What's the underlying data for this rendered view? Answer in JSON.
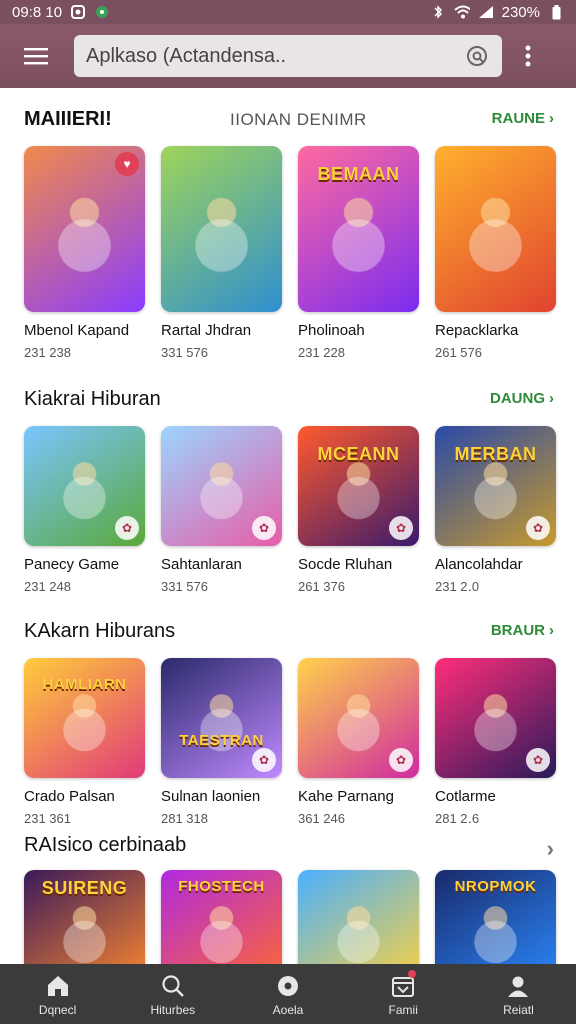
{
  "status_bar": {
    "time": "09:8 10",
    "battery": "230%"
  },
  "search": {
    "placeholder": "Aplkaso (Actandensa.."
  },
  "sections": [
    {
      "title": "MAIIIERI!",
      "subtitle": "IIONAN DENIMR",
      "more": "RAUNE",
      "apps": [
        {
          "name": "Mbenol Kapand",
          "stat": "231 238",
          "banner": "",
          "colors": [
            "#f08a4b",
            "#8a3cff"
          ]
        },
        {
          "name": "Rartal Jhdran",
          "stat": "331 576",
          "banner": "",
          "colors": [
            "#9fd45a",
            "#2f8fd0"
          ]
        },
        {
          "name": "Pholinoah",
          "stat": "231 228",
          "banner": "BEMAAN",
          "colors": [
            "#ff6aa0",
            "#7b2cf0"
          ]
        },
        {
          "name": "Repacklarka",
          "stat": "261 576",
          "banner": "",
          "colors": [
            "#ffb02e",
            "#e0432f"
          ]
        }
      ]
    },
    {
      "title": "Kiakrai Hiburan",
      "subtitle": "",
      "more": "DAUNG",
      "apps": [
        {
          "name": "Panecy Game",
          "stat": "231 248",
          "banner": "",
          "colors": [
            "#7ac5ff",
            "#5aa83a"
          ]
        },
        {
          "name": "Sahtanlaran",
          "stat": "331 576",
          "banner": "",
          "colors": [
            "#9bd5ff",
            "#e85ca8"
          ]
        },
        {
          "name": "Socde Rluhan",
          "stat": "261 376",
          "banner": "MCEANN",
          "colors": [
            "#ff5a2e",
            "#3a1a6b"
          ]
        },
        {
          "name": "Alancolahdar",
          "stat": "231 2․0",
          "banner": "MERBAN",
          "colors": [
            "#2a4aa8",
            "#c89a2e"
          ]
        }
      ]
    },
    {
      "title": "KAkarn Hiburans",
      "subtitle": "",
      "more": "BRAUR",
      "apps": [
        {
          "name": "Crado Palsan",
          "stat": "231 361",
          "banner": "HAMLIARN",
          "colors": [
            "#ffcc3a",
            "#e03a7a"
          ]
        },
        {
          "name": "Sulnan laonien",
          "stat": "281 318",
          "banner": "TAESTRAN",
          "colors": [
            "#2a2a6b",
            "#c08aff"
          ]
        },
        {
          "name": "Kahe Parnang",
          "stat": "361 246",
          "banner": "",
          "colors": [
            "#ffd24a",
            "#d02aa0"
          ]
        },
        {
          "name": "Cotlarme",
          "stat": "281 2․6",
          "banner": "",
          "colors": [
            "#ff2e7a",
            "#2a1a5a"
          ]
        }
      ]
    },
    {
      "title": "RAIsico cerbinaab",
      "subtitle": "",
      "more": "",
      "apps": [
        {
          "name": "",
          "stat": "",
          "banner": "SUIRENG",
          "colors": [
            "#3a1a5a",
            "#ff8a2e"
          ]
        },
        {
          "name": "",
          "stat": "",
          "banner": "FHOSTECH",
          "colors": [
            "#b02ae0",
            "#ff6a2e"
          ]
        },
        {
          "name": "",
          "stat": "",
          "banner": "",
          "colors": [
            "#4ab0ff",
            "#ffd23c"
          ]
        },
        {
          "name": "",
          "stat": "",
          "banner": "NROPMOK",
          "colors": [
            "#1a2a6b",
            "#2a8aff"
          ]
        }
      ]
    }
  ],
  "bottom_nav": [
    {
      "label": "Dqnecl",
      "icon": "home-icon"
    },
    {
      "label": "Hiturbes",
      "icon": "search-icon"
    },
    {
      "label": "Aoela",
      "icon": "location-icon"
    },
    {
      "label": "Famii",
      "icon": "calendar-icon"
    },
    {
      "label": "Reiatl",
      "icon": "person-icon"
    }
  ],
  "theme": {
    "appbar": "#7c4f60",
    "accent_green": "#2e8b3a",
    "nav_bg": "#3b3b3b"
  }
}
